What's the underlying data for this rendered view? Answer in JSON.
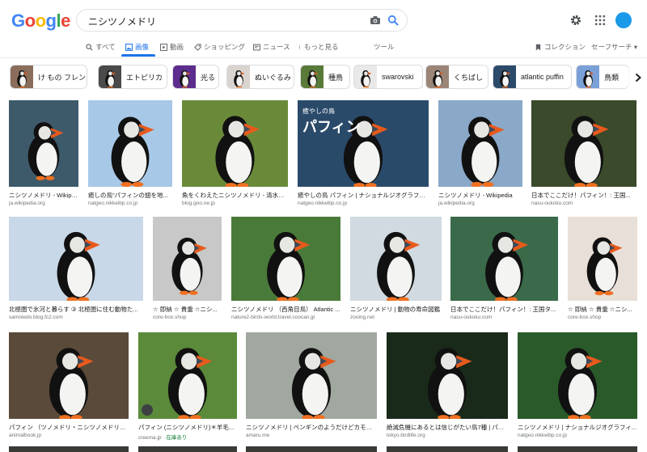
{
  "app": {
    "logo": "Google"
  },
  "search": {
    "query": "ニシツノメドリ"
  },
  "tabs": [
    {
      "label": "すべて",
      "icon": "search-icon"
    },
    {
      "label": "画像",
      "icon": "image-icon",
      "active": true
    },
    {
      "label": "動画",
      "icon": "video-icon"
    },
    {
      "label": "ショッピング",
      "icon": "tag-icon"
    },
    {
      "label": "ニュース",
      "icon": "news-icon"
    },
    {
      "label": "もっと見る",
      "icon": "more-vert-icon"
    },
    {
      "label": "ツール"
    }
  ],
  "right_tabs": {
    "collections": "コレクション",
    "safesearch": "セーフサーチ ▾"
  },
  "chips": [
    {
      "label": "け もの フレンズ",
      "color": "#8a6d5a"
    },
    {
      "label": "エトピリカ",
      "color": "#4a4a4a"
    },
    {
      "label": "光る",
      "color": "#5c2d8c"
    },
    {
      "label": "ぬいぐるみ",
      "color": "#d9d4cf"
    },
    {
      "label": "種鳥",
      "color": "#5a7a3a"
    },
    {
      "label": "swarovski",
      "color": "#e8e8e8"
    },
    {
      "label": "くちばし",
      "color": "#9a8577"
    },
    {
      "label": "atlantic puffin",
      "color": "#2c4a6a"
    },
    {
      "label": "鳥類",
      "color": "#7aa0d8"
    }
  ],
  "results": [
    {
      "caption": "ニシツノメドリ - Wikipedia",
      "source": "ja.wikipedia.org",
      "bg": "#3d5a6b"
    },
    {
      "caption": "癒しの鳥\"パフィンの翅を地...",
      "source": "natgeo.nikkeibp.co.jp",
      "bg": "#a8c8e8"
    },
    {
      "caption": "魚をくわえたニシツノメドリ - 清水正...",
      "source": "blog.goo.ne.jp",
      "bg": "#6a8a3a"
    },
    {
      "caption": "癒やしの鳥 パフィン | ナショナルジオグラフィ...",
      "source": "natgeo.nikkeibp.co.jp",
      "bg": "#2a4a6a",
      "overlay_title": "パフィン",
      "overlay_sub": "癒やしの鳥"
    },
    {
      "caption": "ニシツノメドリ - Wikipedia",
      "source": "ja.wikipedia.org",
      "bg": "#8aa8c8"
    },
    {
      "caption": "日本でここだけ！パフィン！: 王国...",
      "source": "nasu-oukoku.com",
      "bg": "#3a4a2a"
    },
    {
      "caption": "北極圏で氷河と暮らす ③ 北極圏に住む動物た...",
      "source": "samoiedo.blog.fc2.com",
      "bg": "#c8d8e8"
    },
    {
      "caption": "☆ 即納 ☆ 貴重 ☆ニシ...",
      "source": "core-box.shop",
      "bg": "#c8c8c8"
    },
    {
      "caption": "ニシツノメドリ （西角目鳥） Atlantic ...",
      "source": "nature2-birds-world.travel.coocan.jp",
      "bg": "#4a7a3a"
    },
    {
      "caption": "ニシツノメドリ | 動物の寿命図鑑",
      "source": "zooing.net",
      "bg": "#d0dae0"
    },
    {
      "caption": "日本でここだけ！パフィン！: 王国タ...",
      "source": "nasu-oukoku.com",
      "bg": "#3a6a4a"
    },
    {
      "caption": "☆ 即納 ☆ 貴重 ☆ニシ...",
      "source": "core-box.shop",
      "bg": "#e8e0d8"
    },
    {
      "caption": "パフィン （ツノメドリ・ニシツノメドリ・...",
      "source": "animalbook.jp",
      "bg": "#5a4a3a"
    },
    {
      "caption": "パフィン (ニシツノメドリ)＊羊毛...",
      "source": "creema.jp",
      "stock": "在庫あり",
      "bg": "#5a8a3a"
    },
    {
      "caption": "ニシツノメドリ | ペンギンのようだけどカモメ...",
      "source": "amaru.me",
      "bg": "#a0a8a0"
    },
    {
      "caption": "絶滅危機にあるとは信じがたい鳥7種 | パー...",
      "source": "tokyo.birdlife.org",
      "bg": "#1a2a1a"
    },
    {
      "caption": "ニシツノメドリ | ナショナルジオグラフィ...",
      "source": "natgeo.nikkeibp.co.jp",
      "bg": "#2a5a2a"
    }
  ]
}
